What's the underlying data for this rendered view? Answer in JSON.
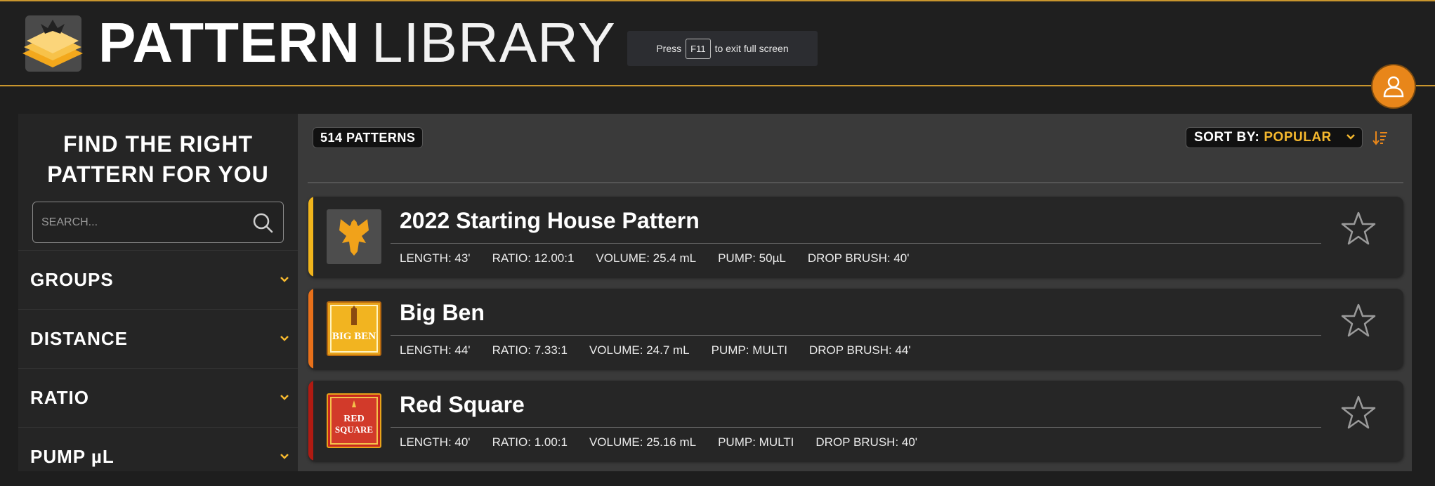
{
  "header": {
    "title_bold": "PATTERN",
    "title_light": "LIBRARY",
    "fullscreen_hint": {
      "before": "Press",
      "key": "F11",
      "after": "to exit full screen"
    },
    "accent_color": "#c9962e",
    "logo_icon": "phoenix-pyramid-icon",
    "account_icon": "user-icon"
  },
  "sidebar": {
    "heading_line1": "FIND THE RIGHT",
    "heading_line2": "PATTERN FOR YOU",
    "search_placeholder": "SEARCH...",
    "filters": [
      {
        "label": "GROUPS"
      },
      {
        "label": "DISTANCE"
      },
      {
        "label": "RATIO"
      },
      {
        "label": "PUMP µL"
      }
    ]
  },
  "results": {
    "count_label": "514 PATTERNS",
    "sort_label": "SORT BY:",
    "sort_value": "POPULAR",
    "sort_options": [
      "POPULAR"
    ],
    "sort_order_icon": "sort-descending-icon",
    "sort_accent": "#f5b82e"
  },
  "patterns": [
    {
      "name": "2022 Starting House Pattern",
      "stripe_color": "#f1b51c",
      "thumb_icon": "phoenix-icon",
      "length": "LENGTH: 43'",
      "ratio": "RATIO: 12.00:1",
      "volume": "VOLUME: 25.4 mL",
      "pump": "PUMP: 50µL",
      "drop_brush": "DROP BRUSH: 40'"
    },
    {
      "name": "Big Ben",
      "stripe_color": "#e8701a",
      "thumb_icon": "big-ben-badge-icon",
      "thumb_text": "BIG BEN",
      "length": "LENGTH: 44'",
      "ratio": "RATIO: 7.33:1",
      "volume": "VOLUME: 24.7 mL",
      "pump": "PUMP: MULTI",
      "drop_brush": "DROP BRUSH: 44'"
    },
    {
      "name": "Red Square",
      "stripe_color": "#b01a12",
      "thumb_icon": "red-square-badge-icon",
      "thumb_text_line1": "RED",
      "thumb_text_line2": "SQUARE",
      "length": "LENGTH: 40'",
      "ratio": "RATIO: 1.00:1",
      "volume": "VOLUME: 25.16 mL",
      "pump": "PUMP: MULTI",
      "drop_brush": "DROP BRUSH: 40'"
    }
  ]
}
